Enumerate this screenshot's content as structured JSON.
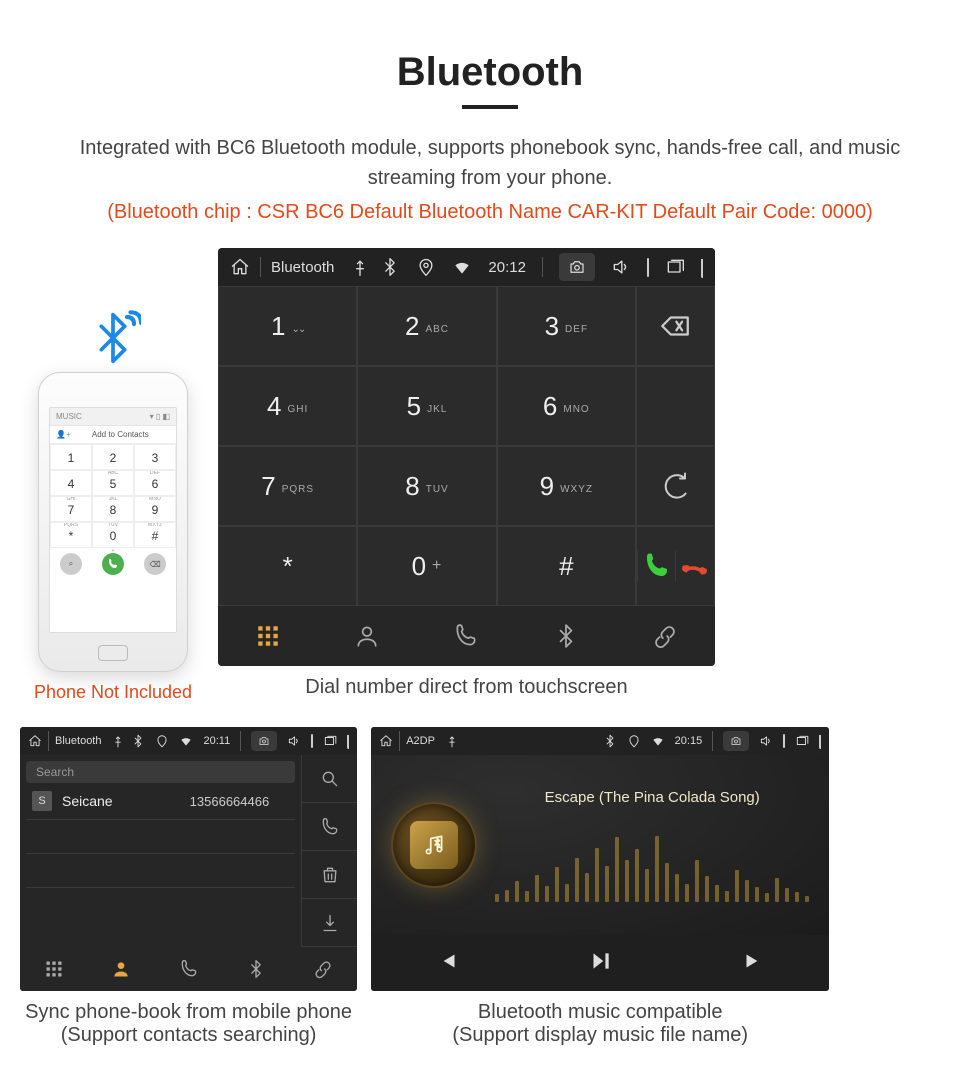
{
  "hero": {
    "title": "Bluetooth",
    "desc": "Integrated with BC6 Bluetooth module, supports phonebook sync, hands-free call, and music streaming from your phone.",
    "specs": "(Bluetooth chip : CSR BC6     Default Bluetooth Name CAR-KIT     Default Pair Code: 0000)"
  },
  "phone": {
    "status_left": "MUSIC",
    "add_contacts": "Add to Contacts",
    "not_included": "Phone Not Included",
    "keys": [
      {
        "d": "1",
        "s": ""
      },
      {
        "d": "2",
        "s": "ABC"
      },
      {
        "d": "3",
        "s": "DEF"
      },
      {
        "d": "4",
        "s": "GHI"
      },
      {
        "d": "5",
        "s": "JKL"
      },
      {
        "d": "6",
        "s": "MNO"
      },
      {
        "d": "7",
        "s": "PQRS"
      },
      {
        "d": "8",
        "s": "TUV"
      },
      {
        "d": "9",
        "s": "WXYZ"
      },
      {
        "d": "*",
        "s": ""
      },
      {
        "d": "0",
        "s": "+"
      },
      {
        "d": "#",
        "s": ""
      }
    ]
  },
  "main_hu": {
    "status": {
      "title": "Bluetooth",
      "time": "20:12"
    },
    "keys": [
      {
        "d": "1",
        "s": "∞"
      },
      {
        "d": "2",
        "s": "ABC"
      },
      {
        "d": "3",
        "s": "DEF"
      },
      {
        "d": "4",
        "s": "GHI"
      },
      {
        "d": "5",
        "s": "JKL"
      },
      {
        "d": "6",
        "s": "MNO"
      },
      {
        "d": "7",
        "s": "PQRS"
      },
      {
        "d": "8",
        "s": "TUV"
      },
      {
        "d": "9",
        "s": "WXYZ"
      },
      {
        "d": "*",
        "s": ""
      },
      {
        "d": "0",
        "s": "+"
      },
      {
        "d": "#",
        "s": ""
      }
    ],
    "caption": "Dial number direct from touchscreen"
  },
  "sm_contacts": {
    "status": {
      "title": "Bluetooth",
      "time": "20:11"
    },
    "search_placeholder": "Search",
    "contact": {
      "badge": "S",
      "name": "Seicane",
      "number": "13566664466"
    },
    "caption_l1": "Sync phone-book from mobile phone",
    "caption_l2": "(Support contacts searching)"
  },
  "sm_a2dp": {
    "status": {
      "title": "A2DP",
      "time": "20:15"
    },
    "track": "Escape (The Pina Colada Song)",
    "bars": [
      12,
      20,
      34,
      18,
      44,
      26,
      58,
      30,
      72,
      48,
      90,
      60,
      108,
      70,
      88,
      54,
      110,
      64,
      46,
      30,
      70,
      42,
      28,
      18,
      52,
      36,
      24,
      14,
      40,
      22,
      16,
      10
    ],
    "caption_l1": "Bluetooth music compatible",
    "caption_l2": "(Support display music file name)"
  }
}
